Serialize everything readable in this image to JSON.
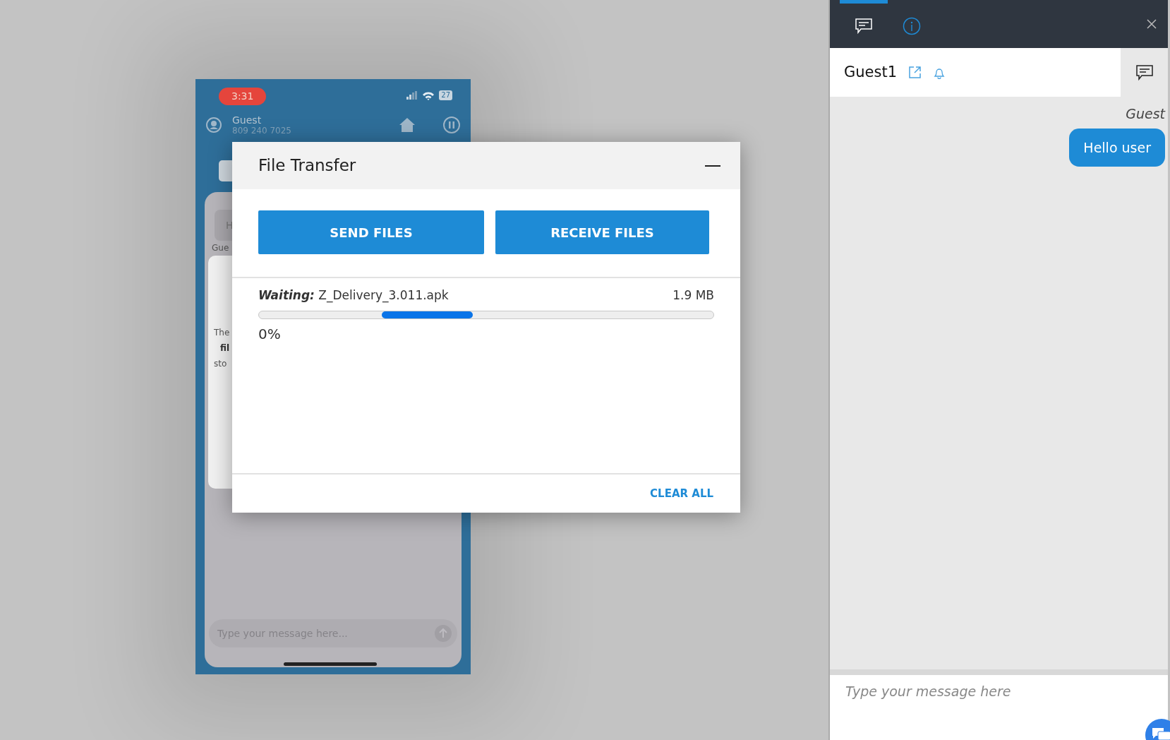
{
  "phone": {
    "time": "3:31",
    "battery": "27",
    "contact_name": "Guest",
    "contact_number": "809 240 7025",
    "card_texts": [
      "H",
      "Gue",
      "The",
      "fil",
      "sto"
    ],
    "message_placeholder": "Type your message here..."
  },
  "file_transfer": {
    "title": "File Transfer",
    "buttons": [
      "SEND FILES",
      "RECEIVE FILES"
    ],
    "transfers": [
      {
        "status": "Waiting:",
        "file": "Z_Delivery_3.011.apk",
        "size": "1.9 MB",
        "percent": "0%"
      }
    ],
    "clear_all": "CLEAR ALL"
  },
  "chat_panel": {
    "tabs": [
      {
        "kind": "chat",
        "selected": true
      },
      {
        "kind": "info",
        "selected": false
      }
    ],
    "contact": "Guest1",
    "messages": [
      {
        "sender": "Guest",
        "text": "Hello user"
      }
    ],
    "input_placeholder": "Type your message here"
  }
}
